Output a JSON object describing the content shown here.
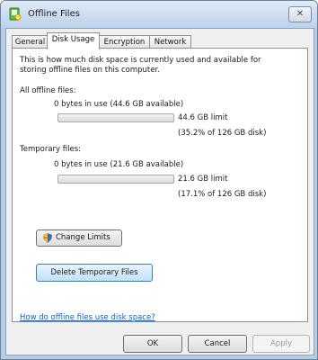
{
  "window": {
    "title": "Offline Files",
    "close_label": "✕"
  },
  "tabs": [
    {
      "label": "General",
      "active": false
    },
    {
      "label": "Disk Usage",
      "active": true
    },
    {
      "label": "Encryption",
      "active": false
    },
    {
      "label": "Network",
      "active": false
    }
  ],
  "disk_usage": {
    "description": "This is how much disk space is currently used and available for storing offline files on this computer.",
    "all_offline": {
      "heading": "All offline files:",
      "usage_text": "0 bytes in use (44.6 GB available)",
      "used_fraction": 0,
      "limit_text": "44.6 GB limit",
      "percent_text": "(35.2% of 126 GB disk)"
    },
    "temporary": {
      "heading": "Temporary files:",
      "usage_text": "0 bytes in use (21.6 GB available)",
      "used_fraction": 0,
      "limit_text": "21.6 GB limit",
      "percent_text": "(17.1% of 126 GB disk)"
    },
    "change_limits_label": "Change Limits",
    "delete_temp_label": "Delete Temporary Files",
    "help_link": "How do offline files use disk space?"
  },
  "footer": {
    "ok_label": "OK",
    "cancel_label": "Cancel",
    "apply_label": "Apply"
  },
  "colors": {
    "link": "#0066cc",
    "accent_button": "#bfe1f6"
  },
  "icons": {
    "app": "offline-files-icon",
    "shield": "uac-shield-icon"
  }
}
